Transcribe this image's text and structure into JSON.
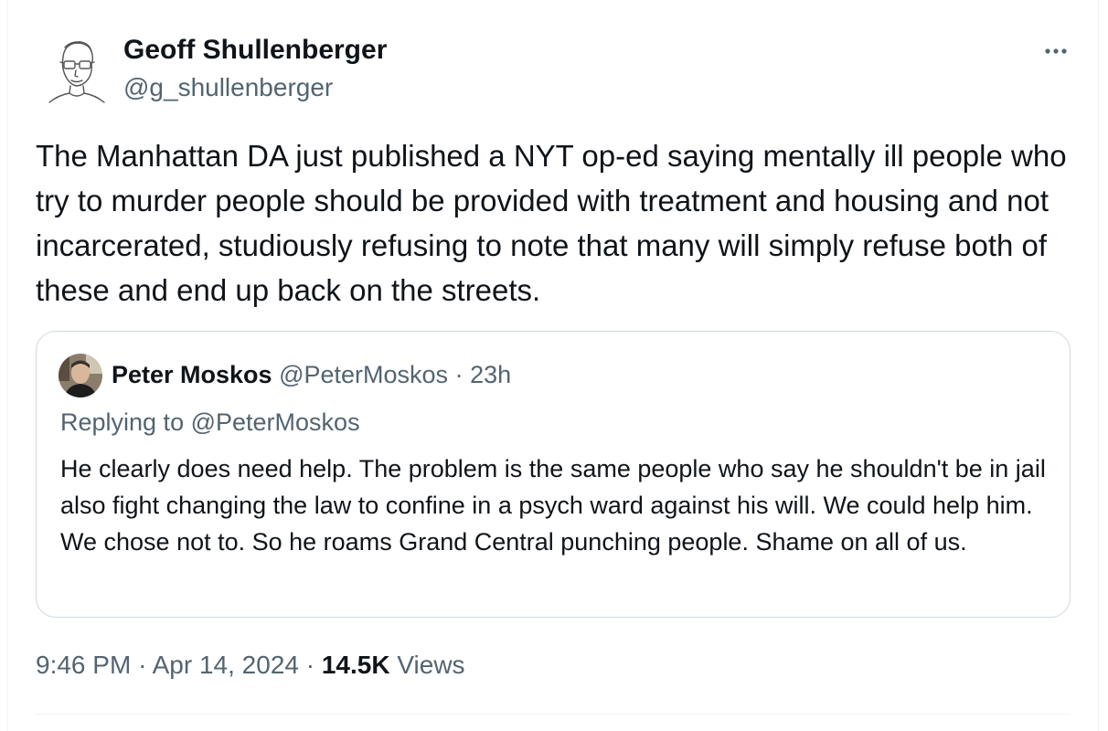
{
  "author": {
    "name": "Geoff Shullenberger",
    "handle": "@g_shullenberger"
  },
  "post": {
    "text": "The Manhattan DA just published a NYT op-ed saying mentally ill people who try to murder people should be provided with treatment and housing and not incarcerated, studiously refusing to note that many will simply refuse both of these and end up back on the streets."
  },
  "quoted": {
    "name": "Peter Moskos",
    "handle": "@PeterMoskos",
    "separator": "·",
    "time": "23h",
    "replying_prefix": "Replying to",
    "replying_handle": "@PeterMoskos",
    "text": "He clearly does need help. The problem is the same people who say he shouldn't be in jail also fight changing the law to confine in a psych ward against his will. We could help him. We chose not to. So he roams Grand Central punching people. Shame on all of us."
  },
  "footer": {
    "time": "9:46 PM",
    "sep1": "·",
    "date": "Apr 14, 2024",
    "sep2": "·",
    "views_count": "14.5K",
    "views_label": "Views"
  },
  "icons": {
    "more": "more-horizontal-icon",
    "avatar": "sketch-portrait",
    "quoted_avatar": "photo-portrait"
  },
  "colors": {
    "text_primary": "#0f1419",
    "text_secondary": "#536471",
    "border": "#cfd9de"
  }
}
